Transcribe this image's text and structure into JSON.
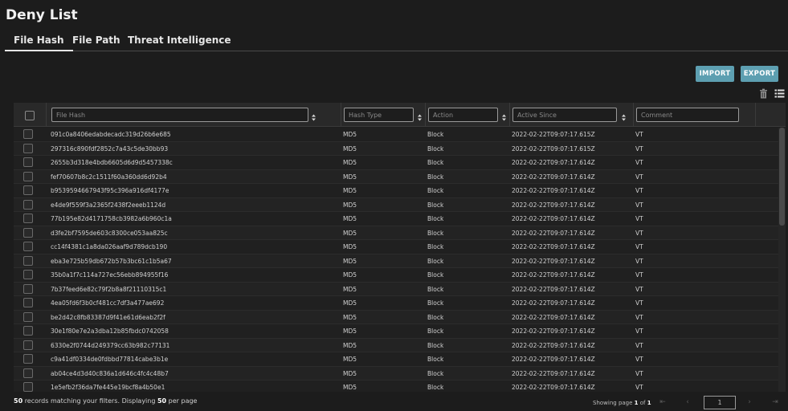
{
  "page": {
    "title": "Deny List"
  },
  "tabs": [
    {
      "label": "File Hash",
      "active": true
    },
    {
      "label": "File Path",
      "active": false
    },
    {
      "label": "Threat Intelligence",
      "active": false
    }
  ],
  "toolbar": {
    "import_label": "IMPORT",
    "export_label": "EXPORT",
    "icons": [
      "trash-icon",
      "columns-list-icon"
    ]
  },
  "table": {
    "filters": [
      {
        "placeholder": "File Hash",
        "value": ""
      },
      {
        "placeholder": "Hash Type",
        "value": ""
      },
      {
        "placeholder": "Action",
        "value": ""
      },
      {
        "placeholder": "Active Since",
        "value": ""
      },
      {
        "placeholder": "Comment",
        "value": ""
      }
    ],
    "rows": [
      [
        "091c0a8406edabdecadc319d26b6e685",
        "MD5",
        "Block",
        "2022-02-22T09:07:17.615Z",
        "VT"
      ],
      [
        "297316c890fdf2852c7a43c5de30bb93",
        "MD5",
        "Block",
        "2022-02-22T09:07:17.615Z",
        "VT"
      ],
      [
        "2655b3d318e4bdb6605d6d9d5457338c",
        "MD5",
        "Block",
        "2022-02-22T09:07:17.614Z",
        "VT"
      ],
      [
        "fef70607b8c2c1511f60a360dd6d92b4",
        "MD5",
        "Block",
        "2022-02-22T09:07:17.614Z",
        "VT"
      ],
      [
        "b9539594667943f95c396a916df4177e",
        "MD5",
        "Block",
        "2022-02-22T09:07:17.614Z",
        "VT"
      ],
      [
        "e4de9f559f3a2365f2438f2eeeb1124d",
        "MD5",
        "Block",
        "2022-02-22T09:07:17.614Z",
        "VT"
      ],
      [
        "77b195e82d4171758cb3982a6b960c1a",
        "MD5",
        "Block",
        "2022-02-22T09:07:17.614Z",
        "VT"
      ],
      [
        "d3fe2bf7595de603c8300ce053aa825c",
        "MD5",
        "Block",
        "2022-02-22T09:07:17.614Z",
        "VT"
      ],
      [
        "cc14f4381c1a8da026aaf9d789dcb190",
        "MD5",
        "Block",
        "2022-02-22T09:07:17.614Z",
        "VT"
      ],
      [
        "eba3e725b59db672b57b3bc61c1b5a67",
        "MD5",
        "Block",
        "2022-02-22T09:07:17.614Z",
        "VT"
      ],
      [
        "35b0a1f7c114a727ec56ebb894955f16",
        "MD5",
        "Block",
        "2022-02-22T09:07:17.614Z",
        "VT"
      ],
      [
        "7b37feed6e82c79f2b8a8f21110315c1",
        "MD5",
        "Block",
        "2022-02-22T09:07:17.614Z",
        "VT"
      ],
      [
        "4ea05fd6f3b0cf481cc7df3a477ae692",
        "MD5",
        "Block",
        "2022-02-22T09:07:17.614Z",
        "VT"
      ],
      [
        "be2d42c8fb83387d9f41e61d6eab2f2f",
        "MD5",
        "Block",
        "2022-02-22T09:07:17.614Z",
        "VT"
      ],
      [
        "30e1f80e7e2a3dba12b85fbdc0742058",
        "MD5",
        "Block",
        "2022-02-22T09:07:17.614Z",
        "VT"
      ],
      [
        "6330e2f0744d249379cc63b982c77131",
        "MD5",
        "Block",
        "2022-02-22T09:07:17.614Z",
        "VT"
      ],
      [
        "c9a41df0334de0fdbbd77814cabe3b1e",
        "MD5",
        "Block",
        "2022-02-22T09:07:17.614Z",
        "VT"
      ],
      [
        "ab04ce4d3d40c836a1d646c4fc4c48b7",
        "MD5",
        "Block",
        "2022-02-22T09:07:17.614Z",
        "VT"
      ],
      [
        "1e5efb2f36da7fe445e19bcf8a4b50e1",
        "MD5",
        "Block",
        "2022-02-22T09:07:17.614Z",
        "VT"
      ]
    ]
  },
  "footer": {
    "record_count": "50",
    "records_text": "records matching your filters. Displaying",
    "per_page": "50",
    "per_page_text": "per page",
    "showing_text": "Showing page",
    "current_page": "1",
    "of_text": "of",
    "total_pages": "1",
    "page_input_value": "1"
  },
  "colors": {
    "accent": "#5d9fb1",
    "background": "#1c1c1c"
  }
}
